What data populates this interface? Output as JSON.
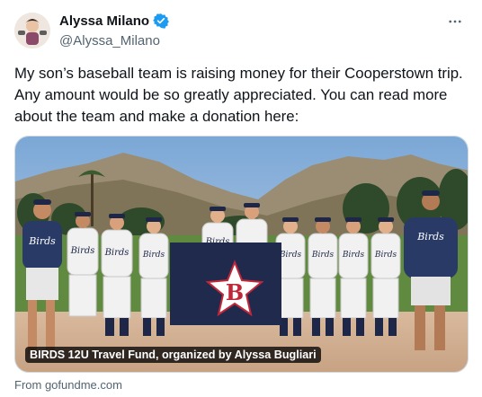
{
  "author": {
    "display_name": "Alyssa Milano",
    "handle": "@Alyssa_Milano",
    "verified_color": "#1d9bf0"
  },
  "tweet": {
    "text": "My son’s baseball team is raising money for their Cooperstown trip. Any amount would be so greatly appreciated. You can read more about the team and make a donation here:"
  },
  "card": {
    "title": "BIRDS 12U Travel Fund, organized by Alyssa Bugliari",
    "source": "From gofundme.com"
  },
  "icons": {
    "more": "more-horizontal-icon",
    "verified": "verified-badge-icon"
  }
}
